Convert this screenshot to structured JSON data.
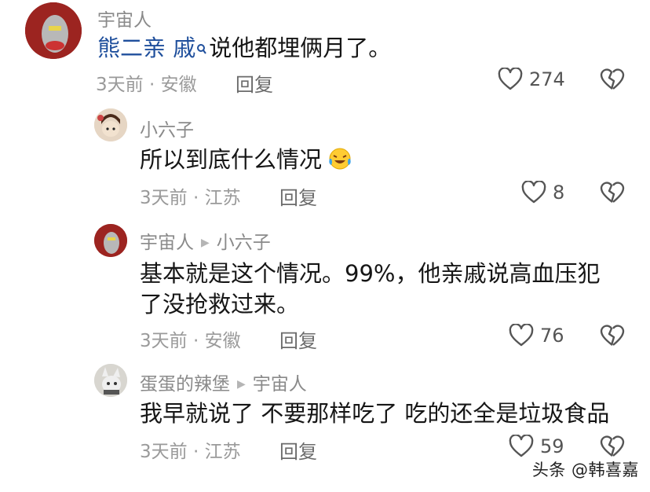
{
  "comments": [
    {
      "author": "宇宙人",
      "mention": "熊二亲 戚",
      "text_after_mention": "说他都埋俩月了。",
      "meta": "3天前 · 安徽",
      "reply_label": "回复",
      "likes": "274"
    },
    {
      "author": "小六子",
      "text": "所以到底什么情况",
      "meta": "3天前 · 江苏",
      "reply_label": "回复",
      "likes": "8"
    },
    {
      "author": "宇宙人",
      "reply_to": "小六子",
      "text_line1": "基本就是这个情况。99%，他亲戚说高血压犯",
      "text_line2": "了没抢救过来。",
      "meta": "3天前 · 安徽",
      "reply_label": "回复",
      "likes": "76"
    },
    {
      "author": "蛋蛋的辣堡",
      "reply_to": "宇宙人",
      "text": "我早就说了 不要那样吃了 吃的还全是垃圾食品",
      "meta": "3天前 · 江苏",
      "reply_label": "回复",
      "likes": "59"
    }
  ],
  "icons": {
    "like": "heart-outline-icon",
    "dislike": "broken-heart-icon",
    "search": "search-icon",
    "emoji": "laughing-tears-emoji-icon",
    "reply_arrow": "reply-arrow-icon"
  },
  "watermark": "头条 @韩喜嘉"
}
